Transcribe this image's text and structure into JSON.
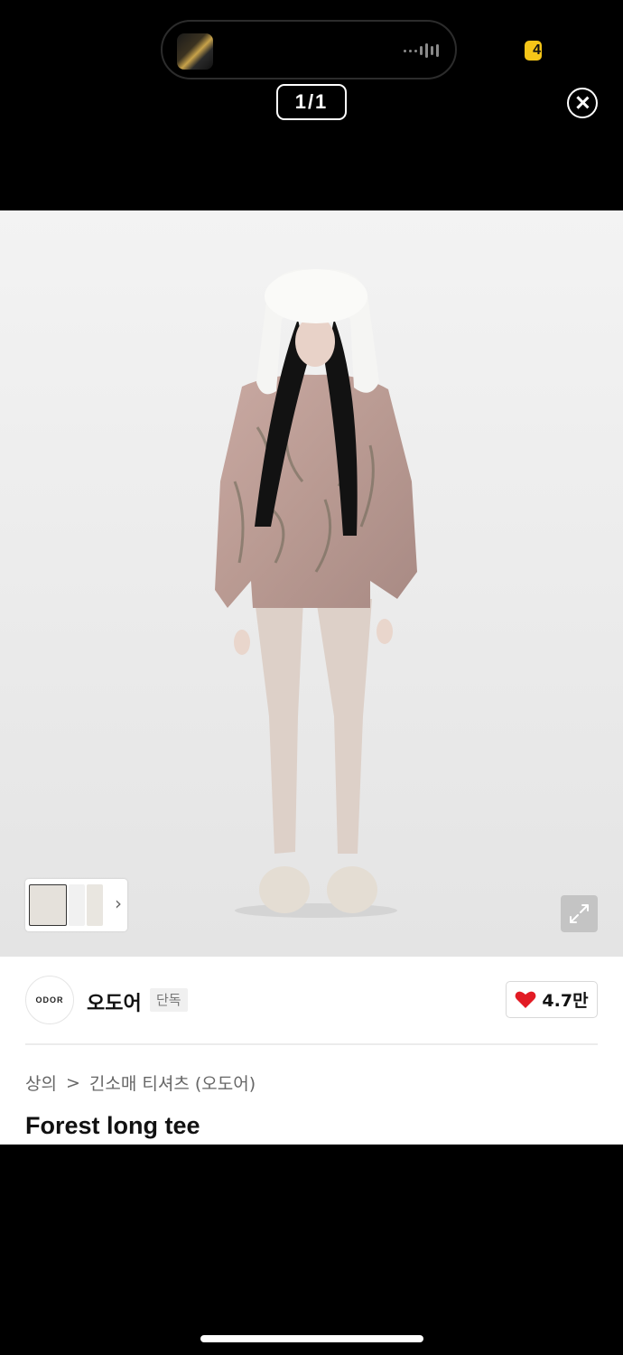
{
  "status_bar": {
    "badge_text": "4",
    "badge_color": "#f5c518"
  },
  "viewer": {
    "page_counter": "1/1",
    "close_icon": "close-circle-icon"
  },
  "gallery": {
    "thumbnail_count": 3,
    "next_icon": "chevron-right-icon",
    "expand_icon": "expand-arrows-icon"
  },
  "brand": {
    "logo_text": "ODOR",
    "name": "오도어",
    "tag": "단독"
  },
  "like": {
    "icon": "heart-icon",
    "color": "#e21b24",
    "count": "4.7만"
  },
  "breadcrumb": {
    "category": "상의",
    "separator": ">",
    "subcategory": "긴소매 티셔츠 (오도어)"
  },
  "product": {
    "title": "Forest long tee"
  }
}
